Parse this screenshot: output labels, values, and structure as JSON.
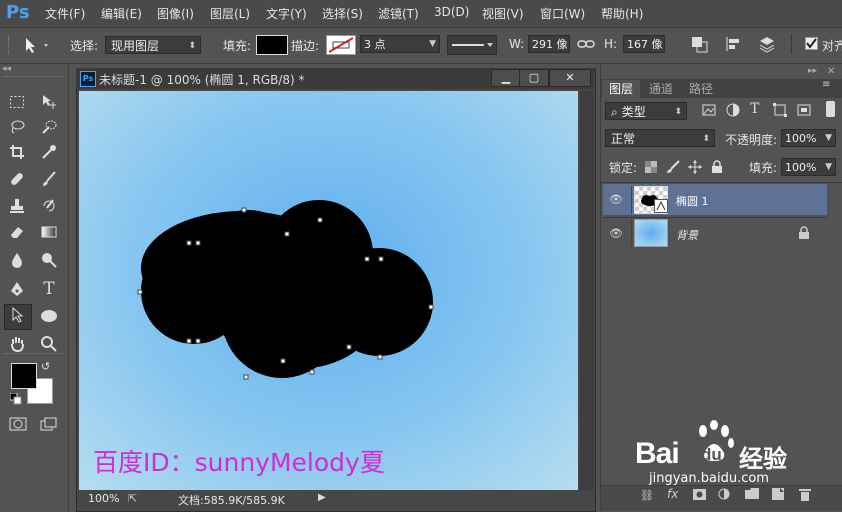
{
  "app": {
    "logo": "Ps"
  },
  "menu": [
    "文件(F)",
    "编辑(E)",
    "图像(I)",
    "图层(L)",
    "文字(Y)",
    "选择(S)",
    "滤镜(T)",
    "3D(D)",
    "视图(V)",
    "窗口(W)",
    "帮助(H)"
  ],
  "options": {
    "select_label": "选择:",
    "select_value": "现用图层",
    "fill_label": "填充:",
    "stroke_label": "描边:",
    "stroke_width": "3 点",
    "w_label": "W:",
    "w_value": "291 像",
    "h_label": "H:",
    "h_value": "167 像",
    "align_label": "对齐"
  },
  "document": {
    "title": "未标题-1 @ 100% (椭圆 1, RGB/8) *",
    "ps_badge": "Ps",
    "zoom": "100%",
    "doc_size": "文档:585.9K/585.9K",
    "watermark_text": "百度ID：sunnyMelody夏"
  },
  "panel": {
    "tabs": [
      "图层",
      "通道",
      "路径"
    ],
    "kind_filter": "类型",
    "blend_mode": "正常",
    "opacity_label": "不透明度:",
    "opacity_value": "100%",
    "lock_label": "锁定:",
    "fill_label": "填充:",
    "fill_value": "100%",
    "layers": [
      {
        "name": "椭圆 1",
        "selected": true
      },
      {
        "name": "背景",
        "selected": false
      }
    ]
  },
  "baidu": {
    "logo_text": "Bai",
    "logo_text2": "du",
    "brand": "经验",
    "url": "jingyan.baidu.com"
  },
  "colors": {
    "accent": "#49a3ef",
    "selected_layer": "#5e7196",
    "watermark": "#d628d4"
  }
}
